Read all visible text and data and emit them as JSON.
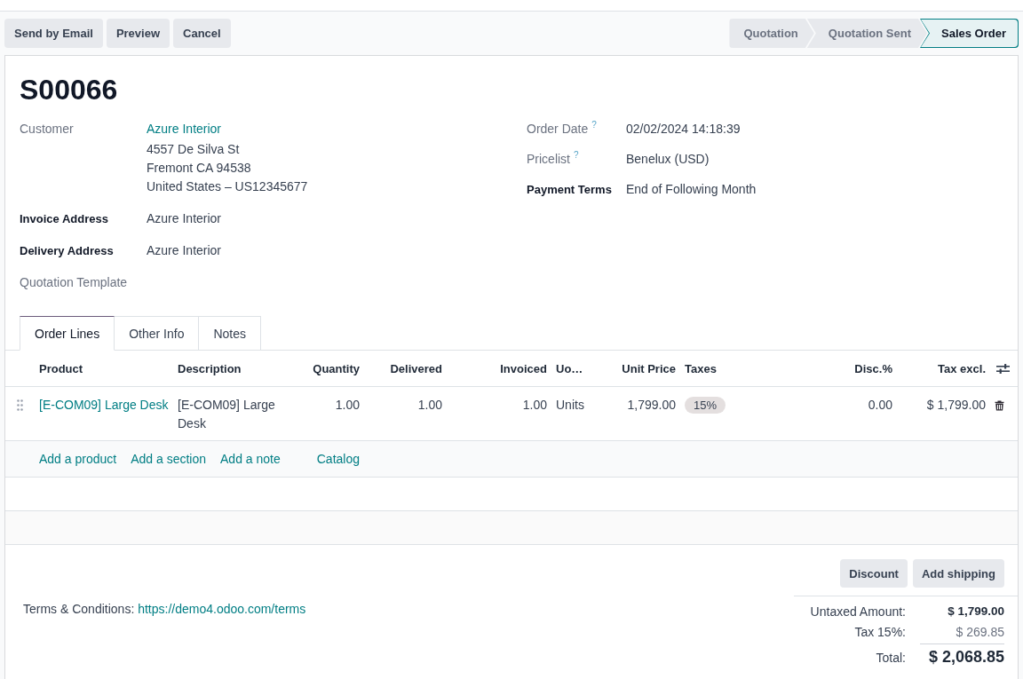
{
  "control_panel": {
    "buttons": [
      "Send by Email",
      "Preview",
      "Cancel"
    ]
  },
  "status_bar": [
    {
      "label": "Quotation",
      "selected": false
    },
    {
      "label": "Quotation Sent",
      "selected": false
    },
    {
      "label": "Sales Order",
      "selected": true
    }
  ],
  "form": {
    "title": "S00066",
    "left_fields": [
      {
        "label": "Customer",
        "readonly": true,
        "value": "Azure Interior",
        "kind": "link",
        "address_lines": [
          "4557 De Silva St",
          "Fremont CA 94538",
          "United States – US12345677"
        ]
      },
      {
        "label": "Invoice Address",
        "readonly": false,
        "value": "Azure Interior",
        "kind": "text"
      },
      {
        "label": "Delivery Address",
        "readonly": false,
        "value": "Azure Interior",
        "kind": "text"
      },
      {
        "label": "Quotation Template",
        "readonly": true
      }
    ],
    "right_fields": [
      {
        "label": "Order Date",
        "readonly": true,
        "help": "?",
        "value": "02/02/2024 14:18:39",
        "kind": "text"
      },
      {
        "label": "Pricelist",
        "readonly": true,
        "help": "?",
        "value": "Benelux (USD)",
        "kind": "text"
      },
      {
        "label": "Payment Terms",
        "readonly": false,
        "value": "End of Following Month",
        "kind": "text"
      }
    ]
  },
  "tabs": [
    {
      "label": "Order Lines",
      "selected": true
    },
    {
      "label": "Other Info",
      "selected": false
    },
    {
      "label": "Notes",
      "selected": false
    }
  ],
  "order_lines": {
    "columns": [
      {
        "label": "Product",
        "kind": "link"
      },
      {
        "label": "Description",
        "kind": "text"
      },
      {
        "label": "Quantity",
        "kind": "number"
      },
      {
        "label": "Delivered",
        "kind": "number"
      },
      {
        "label": "Invoiced",
        "kind": "number"
      },
      {
        "label": "Uo…",
        "kind": "text"
      },
      {
        "label": "Unit Price",
        "kind": "number"
      },
      {
        "label": "Taxes",
        "kind": "tag"
      },
      {
        "label": "Disc.%",
        "kind": "number"
      },
      {
        "label": "Tax excl.",
        "kind": "number"
      }
    ],
    "rows": [
      {
        "cells": [
          "[E-COM09] Large Desk",
          "[E-COM09] Large Desk",
          "1.00",
          "1.00",
          "1.00",
          "Units",
          "1,799.00",
          "15%",
          "0.00",
          "$ 1,799.00"
        ]
      }
    ],
    "add_links": [
      "Add a product",
      "Add a section",
      "Add a note"
    ],
    "catalog_button": "Catalog"
  },
  "footer": {
    "buttons": [
      "Discount",
      "Add shipping"
    ],
    "terms": {
      "label": "Terms & Conditions:",
      "link": "https://demo4.odoo.com/terms"
    },
    "totals": [
      {
        "label": "Untaxed Amount:",
        "value": "$ 1,799.00",
        "kind": "subtotal"
      },
      {
        "label": "Tax 15%:",
        "value": "$ 269.85",
        "kind": "tax"
      },
      {
        "label": "Total:",
        "value": "$ 2,068.85",
        "kind": "total"
      }
    ]
  }
}
